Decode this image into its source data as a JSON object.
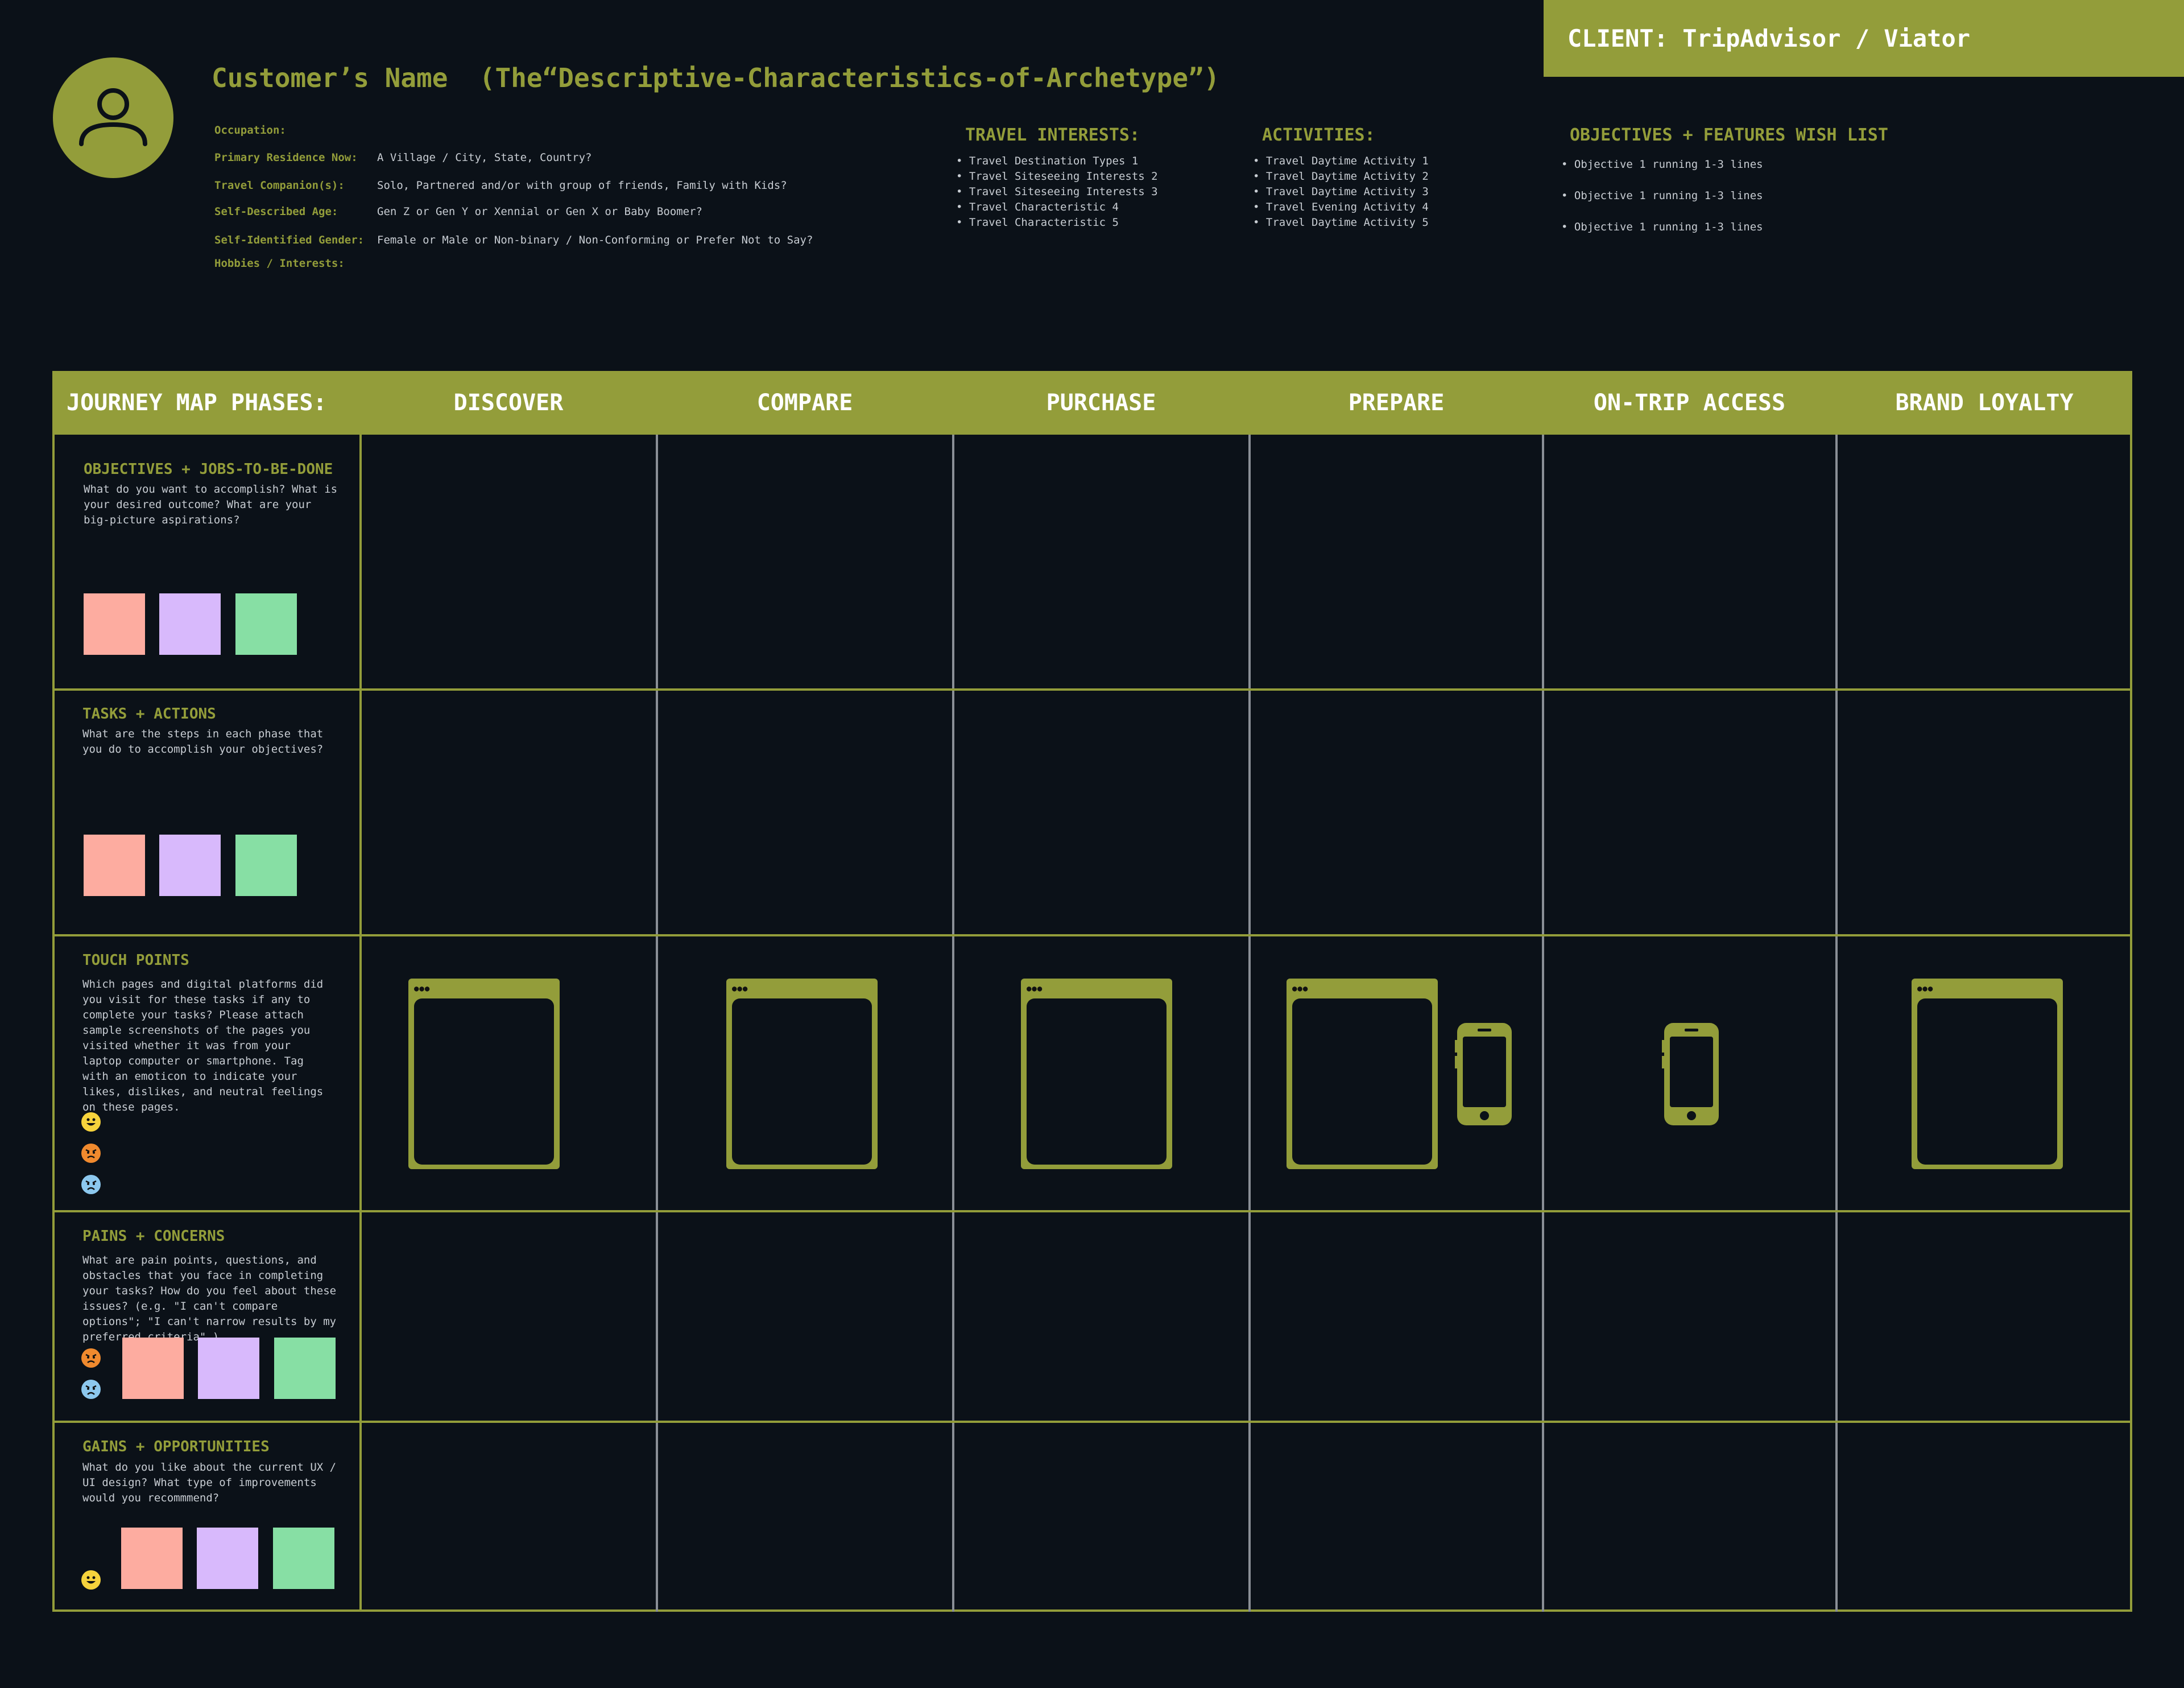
{
  "client": {
    "label": "CLIENT: TripAdvisor / Viator"
  },
  "persona": {
    "title": "Customer’s Name  (The“Descriptive-Characteristics-of-Archetype”)",
    "fields": [
      {
        "label": "Occupation:",
        "value": ""
      },
      {
        "label": "Primary Residence Now:",
        "value": "A Village / City, State, Country?"
      },
      {
        "label": "Travel Companion(s):",
        "value": "Solo, Partnered and/or with group of friends, Family with Kids?"
      },
      {
        "label": "Self-Described Age:",
        "value": "Gen Z or Gen Y or Xennial or Gen X or Baby Boomer?"
      },
      {
        "label": "Self-Identified Gender:",
        "value": "Female or Male or Non-binary / Non-Conforming or Prefer Not to Say?"
      },
      {
        "label": "Hobbies / Interests:",
        "value": ""
      }
    ]
  },
  "travel_interests": {
    "heading": "TRAVEL INTERESTS:",
    "items": [
      "Travel Destination Types 1",
      "Travel Siteseeing Interests 2",
      "Travel Siteseeing Interests 3",
      "Travel Characteristic 4",
      "Travel Characteristic 5"
    ]
  },
  "activities": {
    "heading": "ACTIVITIES:",
    "items": [
      "Travel Daytime Activity 1",
      "Travel Daytime Activity 2",
      "Travel Daytime Activity 3",
      "Travel Evening Activity 4",
      "Travel Daytime Activity 5"
    ]
  },
  "wishlist": {
    "heading": "OBJECTIVES + FEATURES WISH LIST",
    "items": [
      "Objective 1 running 1-3 lines",
      "Objective 1 running 1-3 lines",
      "Objective 1 running 1-3 lines"
    ]
  },
  "journey": {
    "phases_label": "JOURNEY MAP PHASES:",
    "phases": [
      "DISCOVER",
      "COMPARE",
      "PURCHASE",
      "PREPARE",
      "ON-TRIP ACCESS",
      "BRAND LOYALTY"
    ],
    "rows": [
      {
        "title": "OBJECTIVES + JOBS-TO-BE-DONE",
        "desc": "What do you want to accomplish? What is your desired outcome? What are your big-picture aspirations?"
      },
      {
        "title": "TASKS + ACTIONS",
        "desc": "What are the steps in each phase that you do to accomplish your objectives?"
      },
      {
        "title": "TOUCH POINTS",
        "desc": "Which pages and digital platforms did you visit for these tasks if any to complete your tasks? Please attach sample screenshots of the pages you visited whether it was from your laptop computer or smartphone. Tag with an emoticon to indicate your likes, dislikes, and neutral feelings on these pages."
      },
      {
        "title": "PAINS + CONCERNS",
        "desc": "What are pain points, questions, and obstacles that you face in completing your tasks? How do you feel about these issues? (e.g. \"I can't compare options\"; \"I can't narrow results by my preferred criteria\" )"
      },
      {
        "title": "GAINS + OPPORTUNITIES",
        "desc": "What do you like about the current UX / UI design? What type of improvements would you recommmend?"
      }
    ]
  },
  "colors": {
    "accent": "#939d3a",
    "background": "#0b1118",
    "sticky_pink": "#fdaca0",
    "sticky_purple": "#d8b9fc",
    "sticky_green": "#87dfa4"
  },
  "icons": [
    "user-avatar-icon",
    "browser-window-icon",
    "smartphone-icon",
    "happy-face-icon",
    "angry-face-icon",
    "sad-face-icon"
  ]
}
